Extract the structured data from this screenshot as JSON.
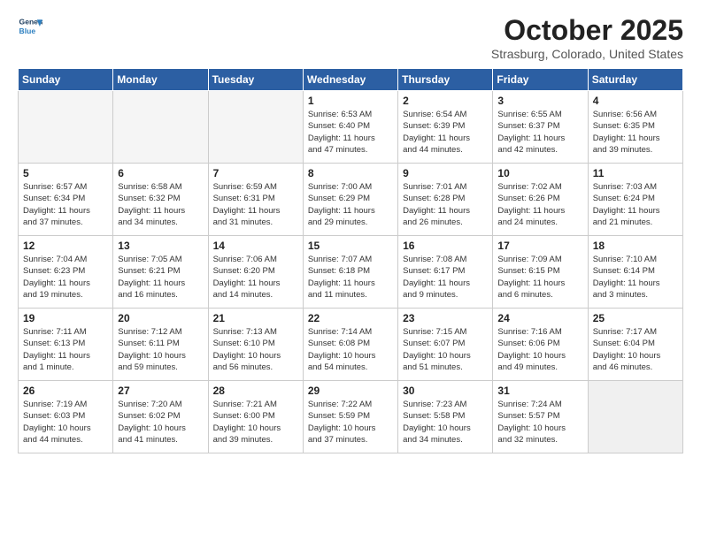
{
  "header": {
    "logo_line1": "General",
    "logo_line2": "Blue",
    "month": "October 2025",
    "location": "Strasburg, Colorado, United States"
  },
  "weekdays": [
    "Sunday",
    "Monday",
    "Tuesday",
    "Wednesday",
    "Thursday",
    "Friday",
    "Saturday"
  ],
  "weeks": [
    [
      {
        "day": "",
        "info": ""
      },
      {
        "day": "",
        "info": ""
      },
      {
        "day": "",
        "info": ""
      },
      {
        "day": "1",
        "info": "Sunrise: 6:53 AM\nSunset: 6:40 PM\nDaylight: 11 hours\nand 47 minutes."
      },
      {
        "day": "2",
        "info": "Sunrise: 6:54 AM\nSunset: 6:39 PM\nDaylight: 11 hours\nand 44 minutes."
      },
      {
        "day": "3",
        "info": "Sunrise: 6:55 AM\nSunset: 6:37 PM\nDaylight: 11 hours\nand 42 minutes."
      },
      {
        "day": "4",
        "info": "Sunrise: 6:56 AM\nSunset: 6:35 PM\nDaylight: 11 hours\nand 39 minutes."
      }
    ],
    [
      {
        "day": "5",
        "info": "Sunrise: 6:57 AM\nSunset: 6:34 PM\nDaylight: 11 hours\nand 37 minutes."
      },
      {
        "day": "6",
        "info": "Sunrise: 6:58 AM\nSunset: 6:32 PM\nDaylight: 11 hours\nand 34 minutes."
      },
      {
        "day": "7",
        "info": "Sunrise: 6:59 AM\nSunset: 6:31 PM\nDaylight: 11 hours\nand 31 minutes."
      },
      {
        "day": "8",
        "info": "Sunrise: 7:00 AM\nSunset: 6:29 PM\nDaylight: 11 hours\nand 29 minutes."
      },
      {
        "day": "9",
        "info": "Sunrise: 7:01 AM\nSunset: 6:28 PM\nDaylight: 11 hours\nand 26 minutes."
      },
      {
        "day": "10",
        "info": "Sunrise: 7:02 AM\nSunset: 6:26 PM\nDaylight: 11 hours\nand 24 minutes."
      },
      {
        "day": "11",
        "info": "Sunrise: 7:03 AM\nSunset: 6:24 PM\nDaylight: 11 hours\nand 21 minutes."
      }
    ],
    [
      {
        "day": "12",
        "info": "Sunrise: 7:04 AM\nSunset: 6:23 PM\nDaylight: 11 hours\nand 19 minutes."
      },
      {
        "day": "13",
        "info": "Sunrise: 7:05 AM\nSunset: 6:21 PM\nDaylight: 11 hours\nand 16 minutes."
      },
      {
        "day": "14",
        "info": "Sunrise: 7:06 AM\nSunset: 6:20 PM\nDaylight: 11 hours\nand 14 minutes."
      },
      {
        "day": "15",
        "info": "Sunrise: 7:07 AM\nSunset: 6:18 PM\nDaylight: 11 hours\nand 11 minutes."
      },
      {
        "day": "16",
        "info": "Sunrise: 7:08 AM\nSunset: 6:17 PM\nDaylight: 11 hours\nand 9 minutes."
      },
      {
        "day": "17",
        "info": "Sunrise: 7:09 AM\nSunset: 6:15 PM\nDaylight: 11 hours\nand 6 minutes."
      },
      {
        "day": "18",
        "info": "Sunrise: 7:10 AM\nSunset: 6:14 PM\nDaylight: 11 hours\nand 3 minutes."
      }
    ],
    [
      {
        "day": "19",
        "info": "Sunrise: 7:11 AM\nSunset: 6:13 PM\nDaylight: 11 hours\nand 1 minute."
      },
      {
        "day": "20",
        "info": "Sunrise: 7:12 AM\nSunset: 6:11 PM\nDaylight: 10 hours\nand 59 minutes."
      },
      {
        "day": "21",
        "info": "Sunrise: 7:13 AM\nSunset: 6:10 PM\nDaylight: 10 hours\nand 56 minutes."
      },
      {
        "day": "22",
        "info": "Sunrise: 7:14 AM\nSunset: 6:08 PM\nDaylight: 10 hours\nand 54 minutes."
      },
      {
        "day": "23",
        "info": "Sunrise: 7:15 AM\nSunset: 6:07 PM\nDaylight: 10 hours\nand 51 minutes."
      },
      {
        "day": "24",
        "info": "Sunrise: 7:16 AM\nSunset: 6:06 PM\nDaylight: 10 hours\nand 49 minutes."
      },
      {
        "day": "25",
        "info": "Sunrise: 7:17 AM\nSunset: 6:04 PM\nDaylight: 10 hours\nand 46 minutes."
      }
    ],
    [
      {
        "day": "26",
        "info": "Sunrise: 7:19 AM\nSunset: 6:03 PM\nDaylight: 10 hours\nand 44 minutes."
      },
      {
        "day": "27",
        "info": "Sunrise: 7:20 AM\nSunset: 6:02 PM\nDaylight: 10 hours\nand 41 minutes."
      },
      {
        "day": "28",
        "info": "Sunrise: 7:21 AM\nSunset: 6:00 PM\nDaylight: 10 hours\nand 39 minutes."
      },
      {
        "day": "29",
        "info": "Sunrise: 7:22 AM\nSunset: 5:59 PM\nDaylight: 10 hours\nand 37 minutes."
      },
      {
        "day": "30",
        "info": "Sunrise: 7:23 AM\nSunset: 5:58 PM\nDaylight: 10 hours\nand 34 minutes."
      },
      {
        "day": "31",
        "info": "Sunrise: 7:24 AM\nSunset: 5:57 PM\nDaylight: 10 hours\nand 32 minutes."
      },
      {
        "day": "",
        "info": ""
      }
    ]
  ]
}
